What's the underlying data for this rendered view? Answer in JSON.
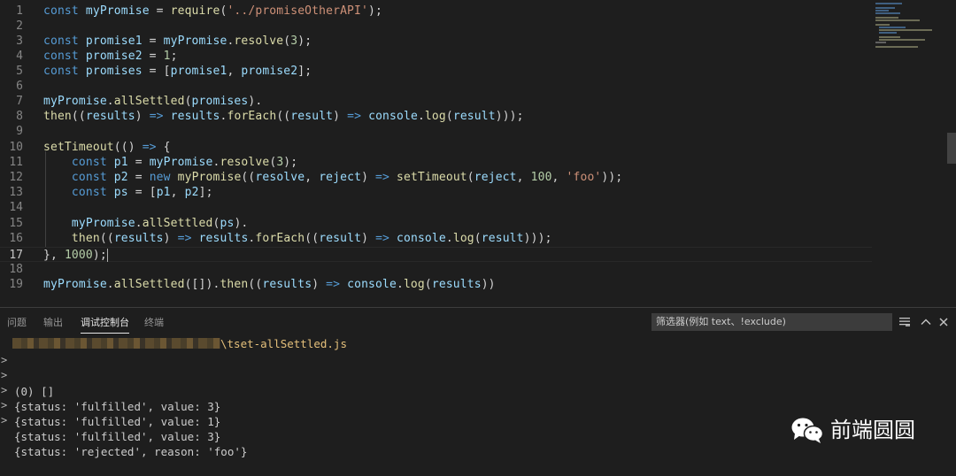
{
  "editor": {
    "line_numbers": [
      "1",
      "2",
      "3",
      "4",
      "5",
      "6",
      "7",
      "8",
      "9",
      "10",
      "11",
      "12",
      "13",
      "14",
      "15",
      "16",
      "17",
      "18",
      "19"
    ],
    "active_line": "17"
  },
  "panel": {
    "tabs": [
      "问题",
      "输出",
      "调试控制台",
      "终端"
    ],
    "active_tab": "调试控制台",
    "filter_placeholder": "筛选器(例如 text、!exclude)",
    "output": {
      "file_path": "\\tset-allSettled.js",
      "lines": [
        "(0) []",
        "{status: 'fulfilled', value: 3}",
        "{status: 'fulfilled', value: 1}",
        "{status: 'fulfilled', value: 3}",
        "{status: 'rejected', reason: 'foo'}"
      ]
    }
  },
  "watermark": {
    "text": "前端圆圆"
  },
  "icons": [
    "list-filter-icon",
    "chevron-up-icon",
    "close-icon",
    "chevron-right-icon",
    "wechat-icon"
  ]
}
